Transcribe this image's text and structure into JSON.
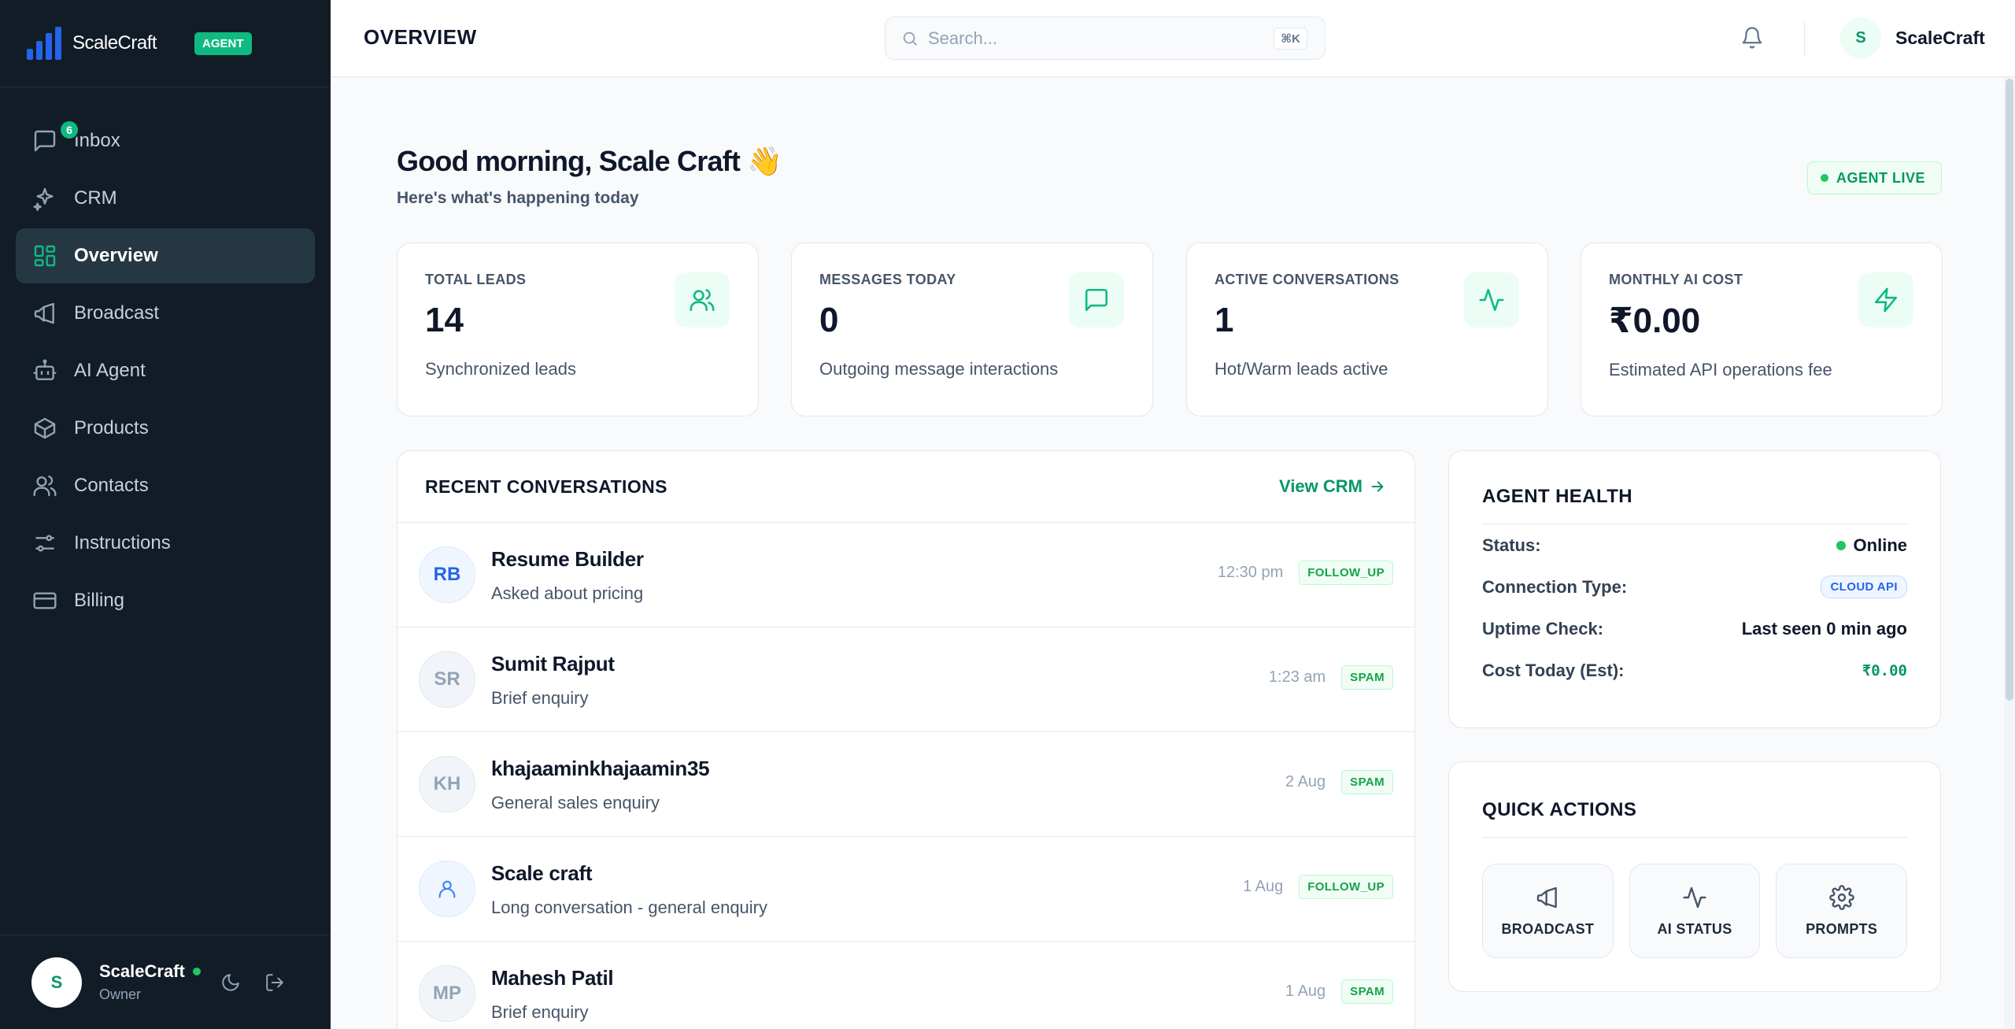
{
  "brand": {
    "name": "ScaleCraft",
    "badge": "AGENT",
    "accent": "#10b981"
  },
  "sidebar": {
    "items": [
      {
        "label": "Inbox",
        "icon": "message-icon",
        "badge": "6"
      },
      {
        "label": "CRM",
        "icon": "sparkles-icon"
      },
      {
        "label": "Overview",
        "icon": "grid-icon",
        "active": true
      },
      {
        "label": "Broadcast",
        "icon": "megaphone-icon"
      },
      {
        "label": "AI Agent",
        "icon": "bot-icon"
      },
      {
        "label": "Products",
        "icon": "box-icon"
      },
      {
        "label": "Contacts",
        "icon": "users-icon"
      },
      {
        "label": "Instructions",
        "icon": "sliders-icon"
      },
      {
        "label": "Billing",
        "icon": "card-icon"
      }
    ],
    "user": {
      "initial": "S",
      "name": "ScaleCraft",
      "role": "Owner"
    }
  },
  "header": {
    "title": "OVERVIEW",
    "search_placeholder": "Search...",
    "shortcut": "⌘K",
    "user": {
      "initial": "S",
      "name": "ScaleCraft"
    }
  },
  "greeting": {
    "title": "Good morning, Scale Craft 👋",
    "subtitle": "Here's what's happening today",
    "status": "AGENT LIVE"
  },
  "stats": [
    {
      "label": "TOTAL LEADS",
      "value": "14",
      "desc": "Synchronized leads",
      "icon": "users-icon"
    },
    {
      "label": "MESSAGES TODAY",
      "value": "0",
      "desc": "Outgoing message interactions",
      "icon": "message-icon"
    },
    {
      "label": "ACTIVE CONVERSATIONS",
      "value": "1",
      "desc": "Hot/Warm leads active",
      "icon": "activity-icon"
    },
    {
      "label": "MONTHLY AI COST",
      "value": "₹0.00",
      "desc": "Estimated API operations fee",
      "icon": "zap-icon"
    }
  ],
  "conversations": {
    "title": "RECENT CONVERSATIONS",
    "view_all": "View CRM",
    "rows": [
      {
        "initials": "RB",
        "name": "Resume Builder",
        "message": "Asked about pricing",
        "time": "12:30 pm",
        "tag": "FOLLOW_UP"
      },
      {
        "initials": "SR",
        "name": "Sumit Rajput",
        "message": "Brief enquiry",
        "time": "1:23 am",
        "tag": "SPAM"
      },
      {
        "initials": "KH",
        "name": "khajaaminkhajaamin35",
        "message": "General sales enquiry",
        "time": "2 Aug",
        "tag": "SPAM"
      },
      {
        "initials": "",
        "name": "Scale craft",
        "message": "Long conversation - general enquiry",
        "time": "1 Aug",
        "tag": "FOLLOW_UP"
      },
      {
        "initials": "MP",
        "name": "Mahesh Patil",
        "message": "Brief enquiry",
        "time": "1 Aug",
        "tag": "SPAM"
      }
    ]
  },
  "health": {
    "title": "AGENT HEALTH",
    "status_label": "Status:",
    "status_value": "Online",
    "conn_label": "Connection Type:",
    "conn_value": "CLOUD API",
    "uptime_label": "Uptime Check:",
    "uptime_value": "Last seen 0 min ago",
    "cost_label": "Cost Today (Est):",
    "cost_value": "₹0.00"
  },
  "quick_actions": {
    "title": "QUICK ACTIONS",
    "items": [
      {
        "label": "BROADCAST",
        "icon": "megaphone-icon"
      },
      {
        "label": "AI STATUS",
        "icon": "activity-icon"
      },
      {
        "label": "PROMPTS",
        "icon": "gear-icon"
      }
    ]
  }
}
